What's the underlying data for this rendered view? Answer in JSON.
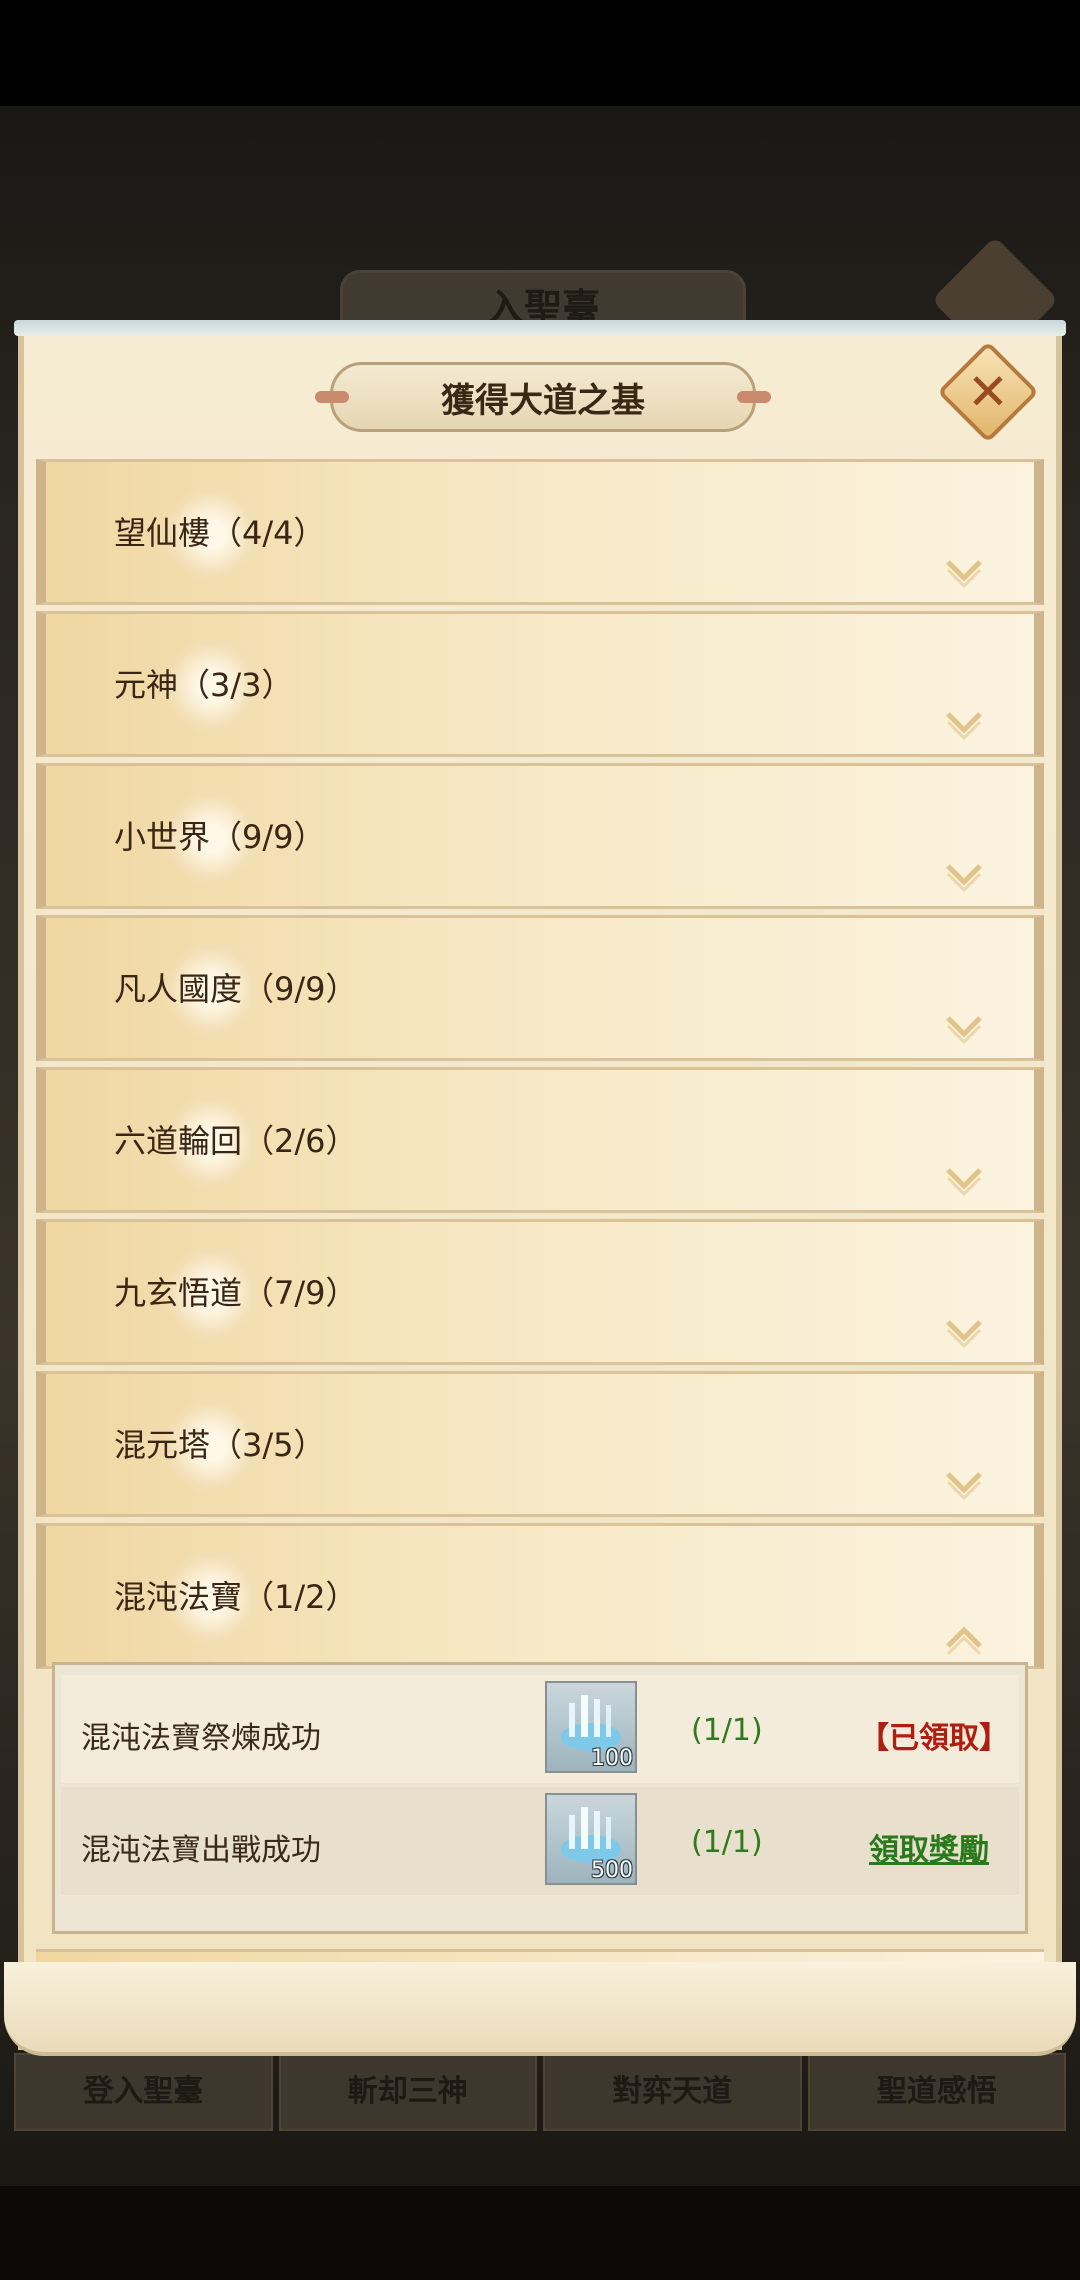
{
  "background": {
    "title": "入聖臺",
    "tabs": [
      "登入聖臺",
      "斬却三神",
      "對弈天道",
      "聖道感悟"
    ]
  },
  "dialog": {
    "title": "獲得大道之基",
    "categories": [
      {
        "label": "望仙樓（4/4）",
        "expanded": false
      },
      {
        "label": "元神（3/3）",
        "expanded": false
      },
      {
        "label": "小世界（9/9）",
        "expanded": false
      },
      {
        "label": "凡人國度（9/9）",
        "expanded": false
      },
      {
        "label": "六道輪回（2/6）",
        "expanded": false
      },
      {
        "label": "九玄悟道（7/9）",
        "expanded": false
      },
      {
        "label": "混元塔（3/5）",
        "expanded": false
      },
      {
        "label": "混沌法寶（1/2）",
        "expanded": true
      }
    ],
    "tasks": [
      {
        "name": "混沌法寶祭煉成功",
        "item_icon": "crystal-item-icon",
        "item_qty": "100",
        "progress": "(1/1)",
        "status": "【已領取】"
      },
      {
        "name": "混沌法寶出戰成功",
        "item_icon": "crystal-item-icon",
        "item_qty": "500",
        "progress": "(1/1)",
        "status": "領取獎勵"
      }
    ]
  },
  "colors": {
    "claimed": "#b01e12",
    "claimable": "#2a7a1c",
    "progress": "#2f7a1c"
  }
}
